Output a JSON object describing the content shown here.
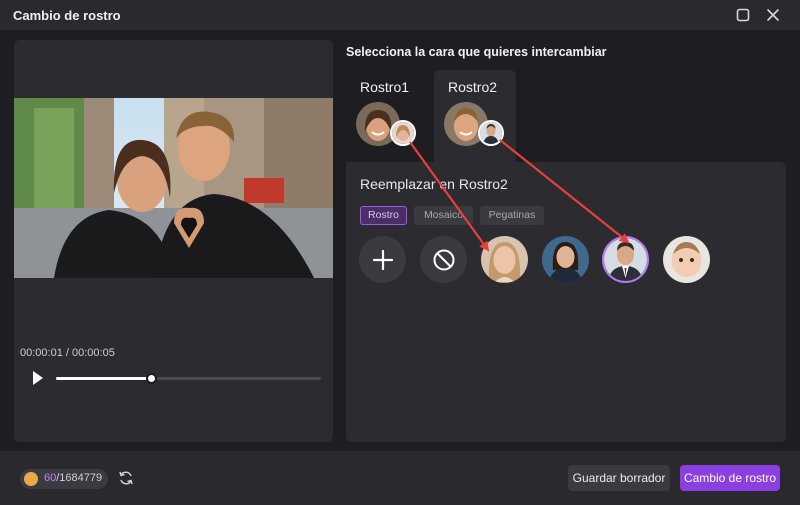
{
  "window": {
    "title": "Cambio de rostro"
  },
  "player": {
    "time": "00:00:01 / 00:00:05",
    "progress": 0.36
  },
  "face_select": {
    "heading": "Selecciona la cara que quieres intercambiar",
    "tabs": [
      {
        "label": "Rostro1",
        "active": false
      },
      {
        "label": "Rostro2",
        "active": true
      }
    ]
  },
  "replace": {
    "title": "Reemplazar en Rostro2",
    "chips": [
      {
        "label": "Rostro",
        "active": true
      },
      {
        "label": "Mosaico",
        "active": false
      },
      {
        "label": "Pegatinas",
        "active": false
      }
    ]
  },
  "footer": {
    "credits_used": "60",
    "credits_total": "/1684779",
    "draft_label": "Guardar borrador",
    "swap_label": "Cambio de rostro"
  },
  "colors": {
    "accent": "#8b3fe0",
    "selected_ring": "#b37cf3",
    "arrow": "#e8413c",
    "panel": "#2b2b30",
    "background": "#1e1e22"
  }
}
